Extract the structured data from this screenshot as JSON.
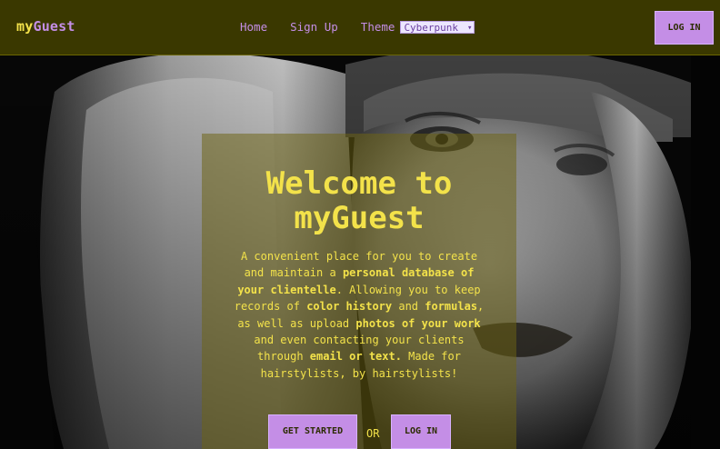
{
  "brand": {
    "prefix": "my",
    "suffix": "Guest"
  },
  "nav": {
    "links": [
      "Home",
      "Sign Up",
      "Theme"
    ],
    "theme_select": {
      "selected": "Cyberpunk"
    },
    "login_label": "LOG IN"
  },
  "hero": {
    "title": "Welcome to myGuest",
    "description": [
      {
        "text": "A convenient place for you to create and maintain a ",
        "bold": false
      },
      {
        "text": "personal database of your clientelle",
        "bold": true
      },
      {
        "text": ". Allowing you to keep records of ",
        "bold": false
      },
      {
        "text": "color history",
        "bold": true
      },
      {
        "text": " and ",
        "bold": false
      },
      {
        "text": "formulas",
        "bold": true
      },
      {
        "text": ", as well as upload ",
        "bold": false
      },
      {
        "text": "photos of your work",
        "bold": true
      },
      {
        "text": " and even contacting your clients through ",
        "bold": false
      },
      {
        "text": "email or text.",
        "bold": true
      },
      {
        "text": " Made for hairstylists, by hairstylists!",
        "bold": false
      }
    ],
    "get_started_label": "GET STARTED",
    "or_label": "OR",
    "login_label": "LOG IN"
  },
  "colors": {
    "navbar_bg": "#3a3800",
    "accent_yellow": "#f3e24a",
    "accent_purple": "#c48ee6"
  }
}
